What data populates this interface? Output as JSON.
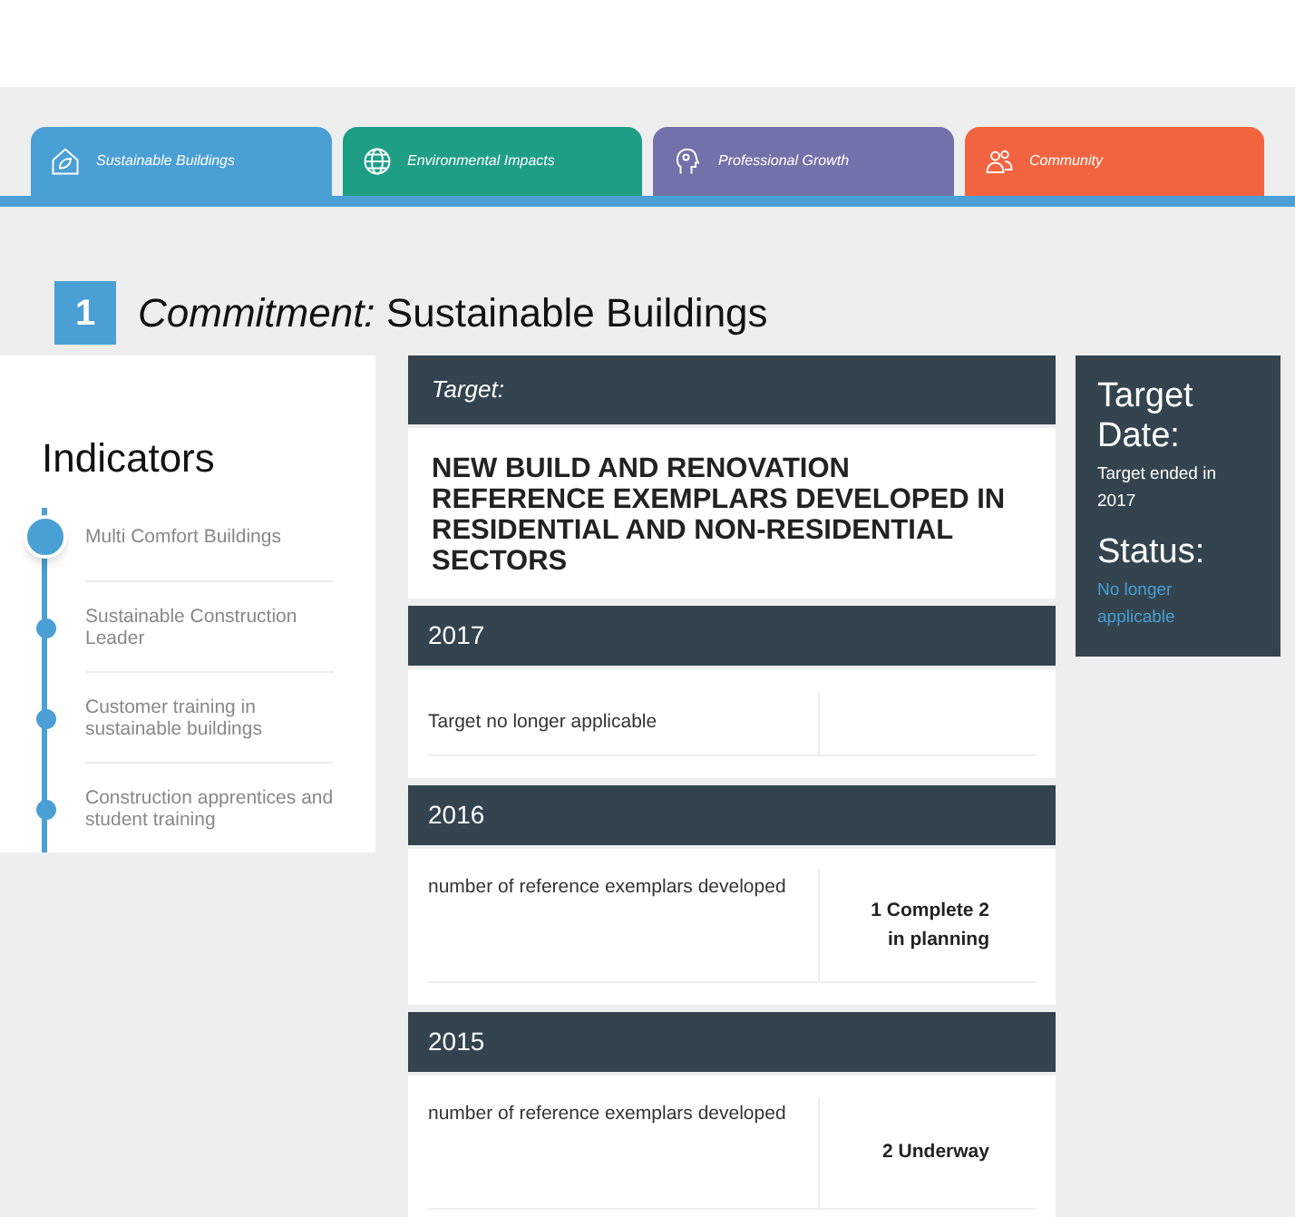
{
  "tabs": [
    {
      "label": "Sustainable Buildings",
      "color": "#4a9fd5"
    },
    {
      "label": "Environmental Impacts",
      "color": "#1f9e86"
    },
    {
      "label": "Professional Growth",
      "color": "#7371a9"
    },
    {
      "label": "Community",
      "color": "#f26440"
    }
  ],
  "commitment": {
    "number": "1",
    "prefix": "Commitment:",
    "title": "Sustainable Buildings"
  },
  "indicators": {
    "title": "Indicators",
    "items": [
      {
        "label": "Multi Comfort Buildings",
        "selected": true
      },
      {
        "label": "Sustainable Construction Leader",
        "selected": false
      },
      {
        "label": "Customer training in sustainable buildings",
        "selected": false
      },
      {
        "label": "Construction apprentices and student training",
        "selected": false
      }
    ]
  },
  "target": {
    "label": "Target:",
    "text": "NEW BUILD AND RENOVATION REFERENCE EXEMPLARS DEVELOPED IN RESIDENTIAL AND NON-RESIDENTIAL SECTORS"
  },
  "years": [
    {
      "year": "2017",
      "description": "Target no longer applicable"
    },
    {
      "year": "2016",
      "description": "number of reference exemplars developed",
      "value": "1 Complete 2 in planning"
    },
    {
      "year": "2015",
      "description": "number of reference exemplars developed",
      "value": "2 Underway"
    }
  ],
  "side": {
    "date_label": "Target Date:",
    "date": "Target ended in 2017",
    "status_label": "Status:",
    "status": "No longer applicable"
  }
}
